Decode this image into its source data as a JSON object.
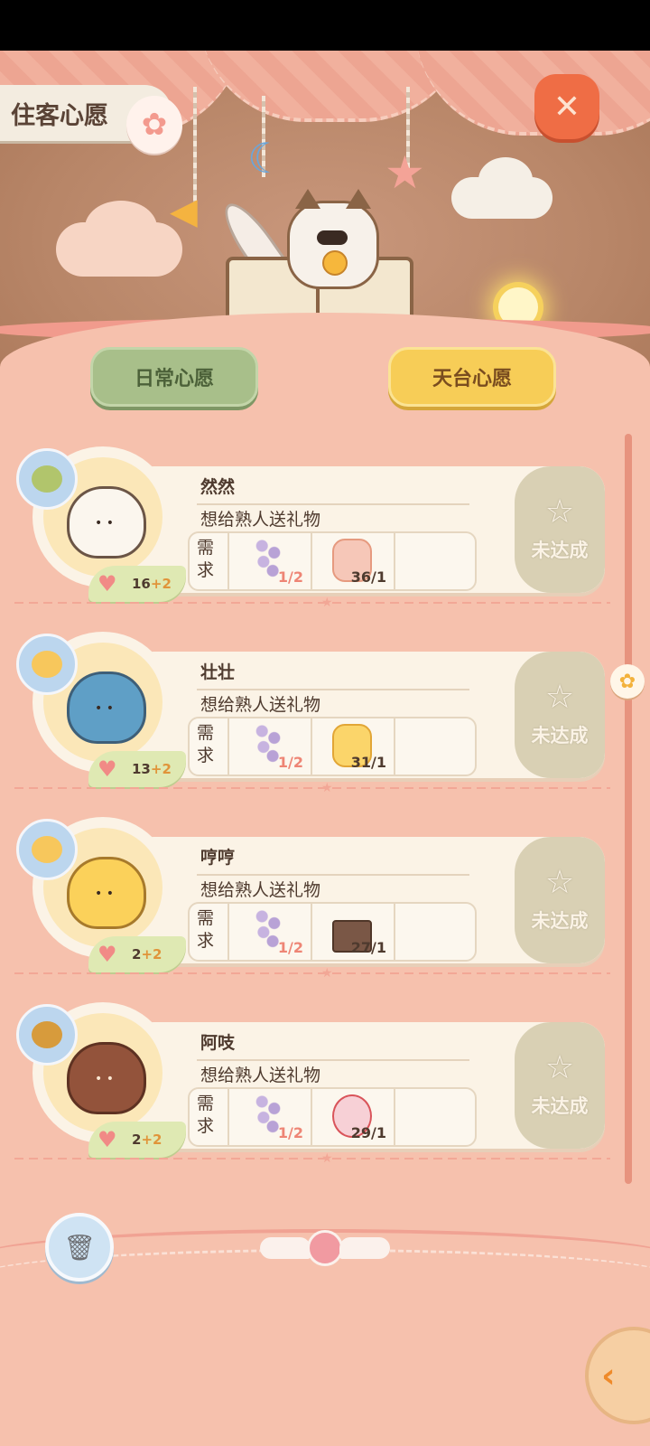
{
  "header": {
    "title": "住客心愿",
    "close_icon": "close-x-icon",
    "paw_icon": "paw-icon"
  },
  "tabs": [
    {
      "label": "日常心愿",
      "selected": false
    },
    {
      "label": "天台心愿",
      "selected": true
    }
  ],
  "wishes": [
    {
      "name": "然然",
      "wish_text": "想给熟人送礼物",
      "requirement_label": "需求",
      "affinity": "16",
      "affinity_bonus": "+2",
      "items": [
        {
          "icon": "lavender-icon",
          "quantity": "1/2"
        },
        {
          "icon": "cat-plush-icon",
          "quantity": "36/1"
        }
      ],
      "status": "未达成"
    },
    {
      "name": "壮壮",
      "wish_text": "想给熟人送礼物",
      "requirement_label": "需求",
      "affinity": "13",
      "affinity_bonus": "+2",
      "items": [
        {
          "icon": "lavender-icon",
          "quantity": "1/2"
        },
        {
          "icon": "chick-pillow-icon",
          "quantity": "31/1"
        }
      ],
      "status": "未达成"
    },
    {
      "name": "哼哼",
      "wish_text": "想给熟人送礼物",
      "requirement_label": "需求",
      "affinity": "2",
      "affinity_bonus": "+2",
      "items": [
        {
          "icon": "lavender-icon",
          "quantity": "1/2"
        },
        {
          "icon": "cat-chest-icon",
          "quantity": "27/1"
        }
      ],
      "status": "未达成"
    },
    {
      "name": "阿吱",
      "wish_text": "想给熟人送礼物",
      "requirement_label": "需求",
      "affinity": "2",
      "affinity_bonus": "+2",
      "items": [
        {
          "icon": "lavender-icon",
          "quantity": "1/2"
        },
        {
          "icon": "snow-globe-icon",
          "quantity": "29/1"
        }
      ],
      "status": "未达成"
    }
  ],
  "footer": {
    "trash_icon": "trash-can-icon",
    "back_icon": "back-arrow-icon"
  },
  "colors": {
    "background": "#f6c1ad",
    "tab_daily": "#a8bf8a",
    "tab_roof": "#f7cd57",
    "status_gray": "#d9d0b4",
    "close_orange": "#ef6d45"
  }
}
